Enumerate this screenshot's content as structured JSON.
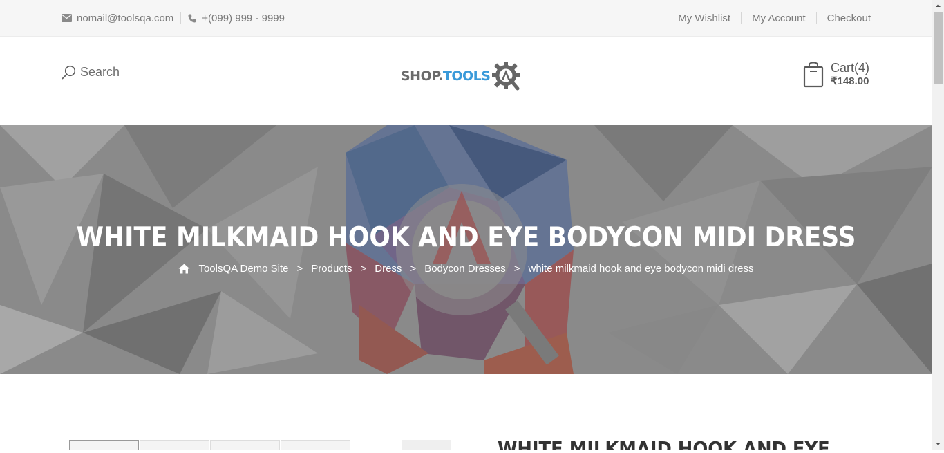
{
  "topbar": {
    "email": "nomail@toolsqa.com",
    "phone": "+(099) 999 - 9999",
    "links": [
      "My Wishlist",
      "My Account",
      "Checkout"
    ]
  },
  "header": {
    "search_label": "Search",
    "logo_shop": "SHOP.",
    "logo_tools": "TOOLS",
    "logo_letter": "A",
    "cart_label": "Cart(4)",
    "cart_price": "₹148.00"
  },
  "banner": {
    "title": "WHITE MILKMAID HOOK AND EYE BODYCON MIDI DRESS",
    "breadcrumb": [
      "ToolsQA Demo Site",
      "Products",
      "Dress",
      "Bodycon Dresses",
      "white milkmaid hook and eye bodycon midi dress"
    ],
    "separator": ">"
  },
  "product": {
    "title_partial": "WHITE MILKMAID HOOK AND EYE"
  },
  "colors": {
    "accent": "#3a9ad9",
    "banner_overlay": "#8f8f8f"
  }
}
